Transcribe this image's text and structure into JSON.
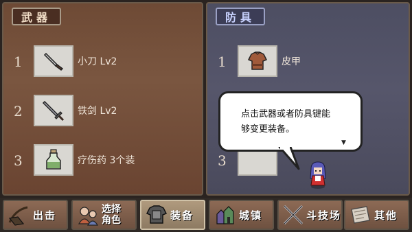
{
  "weapon_panel": {
    "tab_label": "武器",
    "items": [
      {
        "num": "1",
        "name": "小刀 Lv2",
        "icon": "knife-icon"
      },
      {
        "num": "2",
        "name": "铁剑 Lv2",
        "icon": "sword-icon"
      },
      {
        "num": "3",
        "name": "疗伤药 3个装",
        "icon": "potion-icon"
      }
    ]
  },
  "armor_panel": {
    "tab_label": "防具",
    "items": [
      {
        "num": "1",
        "name": "皮甲",
        "icon": "leather-armor-icon"
      },
      {
        "num": "3",
        "name": "",
        "icon": ""
      }
    ]
  },
  "dialog": {
    "line1": "点击武器或者防具键能",
    "line2": "够变更装备。",
    "more_indicator": "▼"
  },
  "nav": {
    "attack": "出击",
    "select_line1": "选择",
    "select_line2": "角色",
    "equip": "装备",
    "town": "城镇",
    "arena": "斗技场",
    "other": "其他"
  },
  "colors": {
    "weapon_bg": "#7a5640",
    "armor_bg": "#56566b",
    "active_nav": "#b09a7e"
  }
}
